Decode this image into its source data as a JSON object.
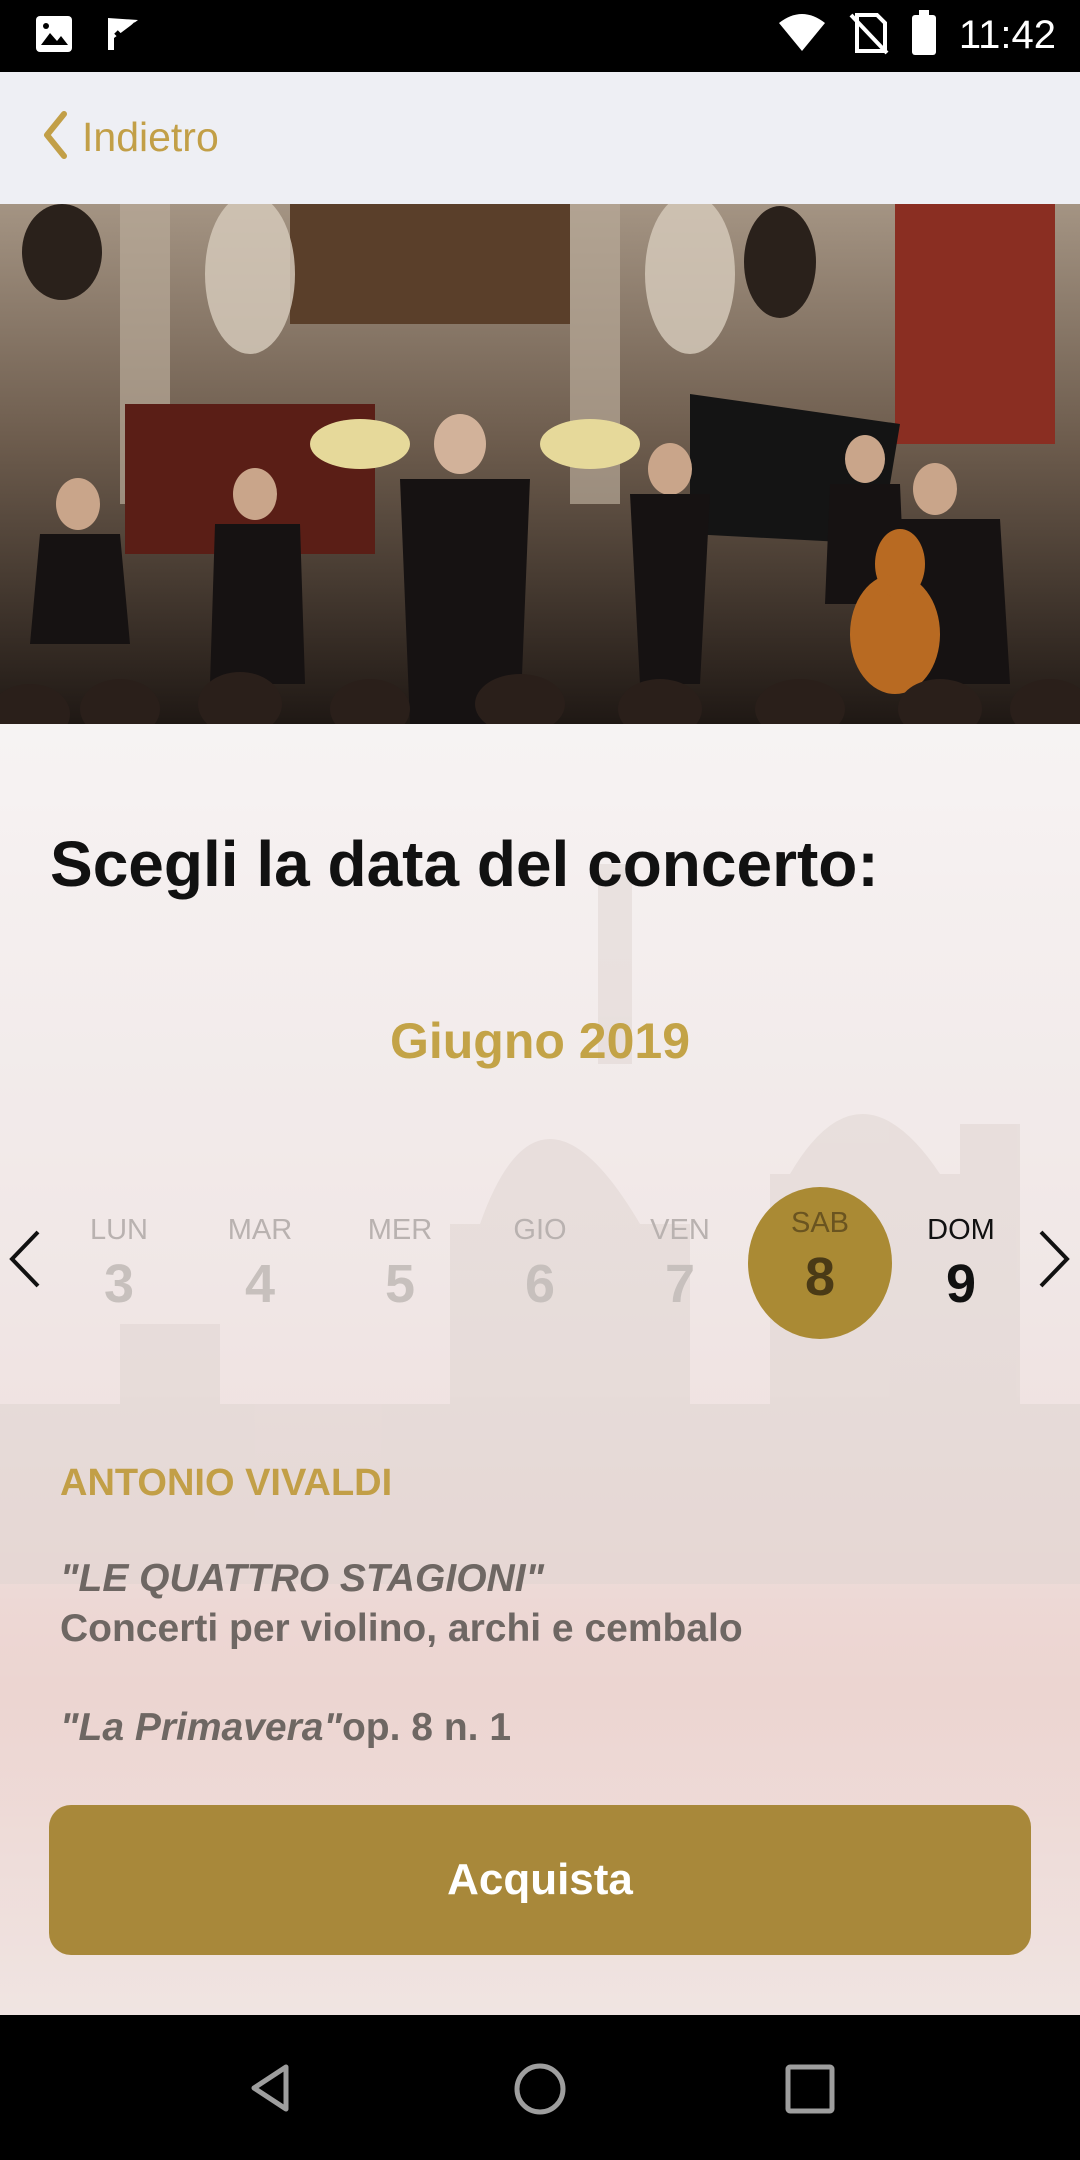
{
  "status_bar": {
    "time": "11:42",
    "icons": [
      "gallery-icon",
      "check-flag-icon",
      "wifi-icon",
      "no-sim-icon",
      "battery-icon"
    ]
  },
  "nav": {
    "back_label": "Indietro",
    "back_icon": "chevron-left-icon"
  },
  "hero": {
    "description_icon": "concert-photo"
  },
  "page": {
    "heading": "Scegli la data del concerto:",
    "month": "Giugno 2019"
  },
  "calendar": {
    "prev_icon": "chevron-left-icon",
    "next_icon": "chevron-right-icon",
    "days": [
      {
        "name": "LUN",
        "num": "3"
      },
      {
        "name": "MAR",
        "num": "4"
      },
      {
        "name": "MER",
        "num": "5"
      },
      {
        "name": "GIO",
        "num": "6"
      },
      {
        "name": "VEN",
        "num": "7"
      },
      {
        "name": "SAB",
        "num": "8"
      },
      {
        "name": "DOM",
        "num": "9"
      }
    ],
    "selected_index": 5
  },
  "program": {
    "composer": "ANTONIO VIVALDI",
    "title": "\"LE QUATTRO STAGIONI\"",
    "subtitle": "Concerti per violino, archi e cembalo",
    "movement_title": "\"La Primavera\"",
    "movement_opus": "op. 8 n. 1"
  },
  "actions": {
    "buy_label": "Acquista"
  },
  "colors": {
    "accent_gold": "#c29f47",
    "button_gold": "#a8883a",
    "selected_day": "#aa8a34"
  },
  "system_nav": {
    "icons": [
      "back-triangle-icon",
      "home-circle-icon",
      "recents-square-icon"
    ]
  }
}
